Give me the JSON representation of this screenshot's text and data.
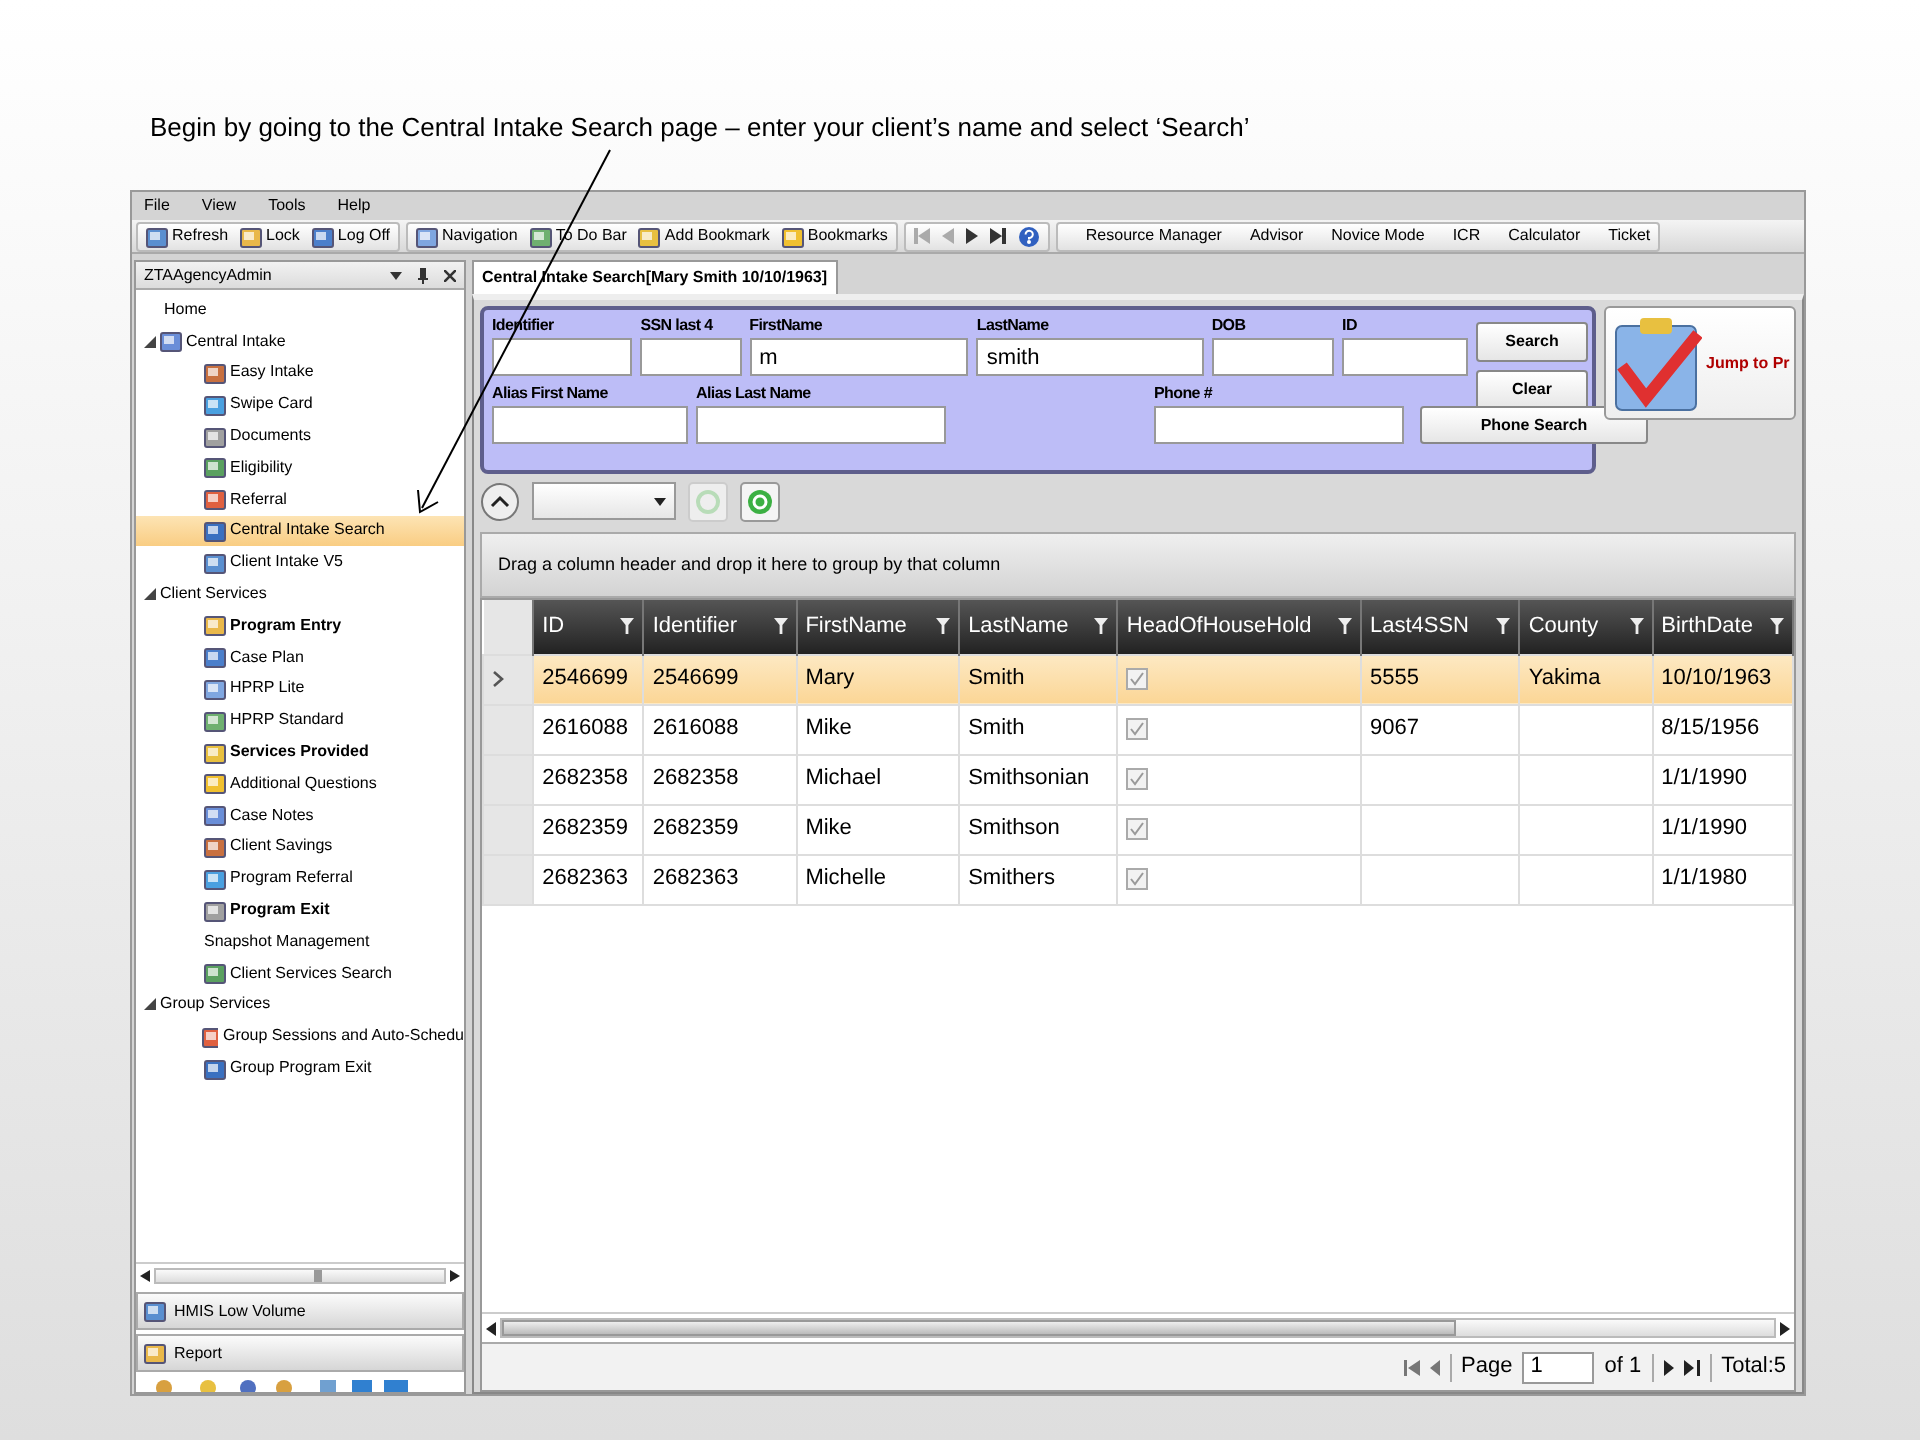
{
  "caption": "Begin by going to the Central Intake Search page – enter your client’s name and select ‘Search’",
  "menu": [
    "File",
    "View",
    "Tools",
    "Help"
  ],
  "toolbar": {
    "group_1": [
      "Refresh",
      "Lock",
      "Log Off"
    ],
    "group_2": [
      "Navigation",
      "To Do Bar",
      "Add Bookmark",
      "Bookmarks"
    ],
    "group_4": [
      "Resource Manager",
      "Advisor",
      "Novice Mode",
      "ICR",
      "Calculator",
      "Ticket"
    ]
  },
  "sidebar": {
    "title": "ZTAAgencyAdmin",
    "items": [
      {
        "label": "Home",
        "icon": false,
        "bold": false,
        "selected": false
      },
      {
        "label": "Central Intake",
        "icon": true,
        "bold": false,
        "selected": false,
        "expanded": true,
        "children": [
          {
            "label": "Easy Intake",
            "icon": true,
            "bold": false,
            "selected": false
          },
          {
            "label": "Swipe Card",
            "icon": true,
            "bold": false,
            "selected": false
          },
          {
            "label": "Documents",
            "icon": true,
            "bold": false,
            "selected": false
          },
          {
            "label": "Eligibility",
            "icon": true,
            "bold": false,
            "selected": false
          },
          {
            "label": "Referral",
            "icon": true,
            "bold": false,
            "selected": false
          },
          {
            "label": "Central Intake Search",
            "icon": true,
            "bold": false,
            "selected": true
          },
          {
            "label": "Client Intake V5",
            "icon": true,
            "bold": false,
            "selected": false
          }
        ]
      },
      {
        "label": "Client Services",
        "icon": false,
        "bold": false,
        "selected": false,
        "expanded": true,
        "children": [
          {
            "label": "Program Entry",
            "icon": true,
            "bold": true,
            "selected": false
          },
          {
            "label": "Case Plan",
            "icon": true,
            "bold": false,
            "selected": false
          },
          {
            "label": "HPRP Lite",
            "icon": true,
            "bold": false,
            "selected": false
          },
          {
            "label": "HPRP Standard",
            "icon": true,
            "bold": false,
            "selected": false
          },
          {
            "label": "Services Provided",
            "icon": true,
            "bold": true,
            "selected": false
          },
          {
            "label": "Additional Questions",
            "icon": true,
            "bold": false,
            "selected": false
          },
          {
            "label": "Case Notes",
            "icon": true,
            "bold": false,
            "selected": false
          },
          {
            "label": "Client Savings",
            "icon": true,
            "bold": false,
            "selected": false
          },
          {
            "label": "Program Referral",
            "icon": true,
            "bold": false,
            "selected": false
          },
          {
            "label": "Program Exit",
            "icon": true,
            "bold": true,
            "selected": false
          },
          {
            "label": "Snapshot Management",
            "icon": false,
            "bold": false,
            "selected": false
          },
          {
            "label": "Client Services Search",
            "icon": true,
            "bold": false,
            "selected": false
          }
        ]
      },
      {
        "label": "Group Services",
        "icon": false,
        "bold": false,
        "selected": false,
        "expanded": true,
        "children": [
          {
            "label": "Group Sessions and Auto-Schedu",
            "icon": true,
            "bold": false,
            "selected": false
          },
          {
            "label": "Group Program Exit",
            "icon": true,
            "bold": false,
            "selected": false
          }
        ]
      }
    ],
    "panels": [
      "HMIS Low Volume",
      "Report"
    ]
  },
  "tab": {
    "label": "Central Intake Search[Mary Smith 10/10/1963]",
    "selected": true
  },
  "search_form": {
    "row_1": [
      {
        "label": "Identifier"
      },
      {
        "label": "SSN last 4"
      },
      {
        "label": "FirstName",
        "value": "m"
      },
      {
        "label": "LastName",
        "value": "smith"
      },
      {
        "label": "DOB"
      },
      {
        "label": "ID"
      }
    ],
    "row_2": [
      {
        "label": "Alias First Name"
      },
      {
        "label": "Alias Last Name"
      },
      {
        "label": "Phone #"
      }
    ],
    "buttons": [
      "Search",
      "Clear",
      "Phone Search"
    ]
  },
  "jump_button": "Jump to Pr",
  "group_panel": "Drag a column header and drop it here to group by that column",
  "table": {
    "columns": [
      {
        "label": "ID",
        "kind": "text"
      },
      {
        "label": "Identifier",
        "kind": "text"
      },
      {
        "label": "FirstName",
        "kind": "text"
      },
      {
        "label": "LastName",
        "kind": "text"
      },
      {
        "label": "HeadOfHouseHold",
        "kind": "checkbox"
      },
      {
        "label": "Last4SSN",
        "kind": "text"
      },
      {
        "label": "County",
        "kind": "text"
      },
      {
        "label": "BirthDate",
        "kind": "text"
      }
    ],
    "rows": [
      {
        "selected": true,
        "id": "2546699",
        "identifier": "2546699",
        "first_name": "Mary",
        "last_name": "Smith",
        "head_of_household": true,
        "last4ssn": "5555",
        "county": "Yakima",
        "birth_date": "10/10/1963"
      },
      {
        "selected": false,
        "id": "2616088",
        "identifier": "2616088",
        "first_name": "Mike",
        "last_name": "Smith",
        "head_of_household": true,
        "last4ssn": "9067",
        "birth_date": "8/15/1956"
      },
      {
        "selected": false,
        "id": "2682358",
        "identifier": "2682358",
        "first_name": "Michael",
        "last_name": "Smithsonian",
        "head_of_household": true,
        "birth_date": "1/1/1990"
      },
      {
        "selected": false,
        "id": "2682359",
        "identifier": "2682359",
        "first_name": "Mike",
        "last_name": "Smithson",
        "head_of_household": true,
        "birth_date": "1/1/1990"
      },
      {
        "selected": false,
        "id": "2682363",
        "identifier": "2682363",
        "first_name": "Michelle",
        "last_name": "Smithers",
        "head_of_household": true,
        "birth_date": "1/1/1980"
      }
    ]
  },
  "pager": {
    "page_label": "Page",
    "page": "1",
    "of": "of 1",
    "total": "Total:5"
  }
}
